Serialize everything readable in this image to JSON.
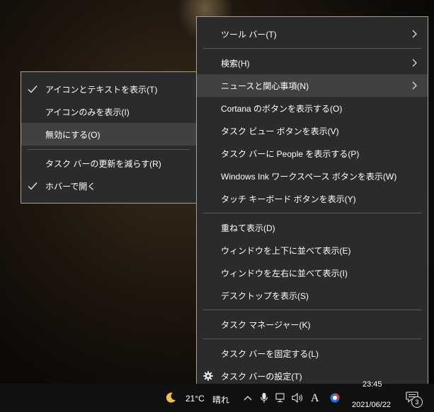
{
  "main_menu": {
    "items": [
      {
        "label": "ツール バー(T)",
        "submenu": true
      },
      {
        "label": "検索(H)",
        "submenu": true
      },
      {
        "label": "ニュースと関心事項(N)",
        "submenu": true
      },
      {
        "label": "Cortana のボタンを表示する(O)"
      },
      {
        "label": "タスク ビュー ボタンを表示(V)"
      },
      {
        "label": "タスク バーに People を表示する(P)"
      },
      {
        "label": "Windows Ink ワークスペース ボタンを表示(W)"
      },
      {
        "label": "タッチ キーボード ボタンを表示(Y)"
      },
      {
        "label": "重ねて表示(D)"
      },
      {
        "label": "ウィンドウを上下に並べて表示(E)"
      },
      {
        "label": "ウィンドウを左右に並べて表示(I)"
      },
      {
        "label": "デスクトップを表示(S)"
      },
      {
        "label": "タスク マネージャー(K)"
      },
      {
        "label": "タスク バーを固定する(L)"
      },
      {
        "label": "タスク バーの設定(T)",
        "icon": "gear-icon"
      }
    ]
  },
  "sub_menu": {
    "items": [
      {
        "label": "アイコンとテキストを表示(T)",
        "checked": true
      },
      {
        "label": "アイコンのみを表示(I)",
        "checked": false
      },
      {
        "label": "無効にする(O)",
        "checked": false
      },
      {
        "label": "タスク バーの更新を減らす(R)",
        "checked": false
      },
      {
        "label": "ホバーで開く",
        "checked": true
      }
    ]
  },
  "taskbar": {
    "weather_icon": "moon-icon",
    "temperature": "21°C",
    "condition": "晴れ",
    "ime_indicator": "A",
    "time": "23:45",
    "date": "2021/06/22",
    "notification_count": "3"
  },
  "colors": {
    "menu_bg": "#2b2b2b",
    "menu_highlight": "#414141",
    "menu_border": "#a0a0a0",
    "taskbar_bg": "#101010"
  }
}
